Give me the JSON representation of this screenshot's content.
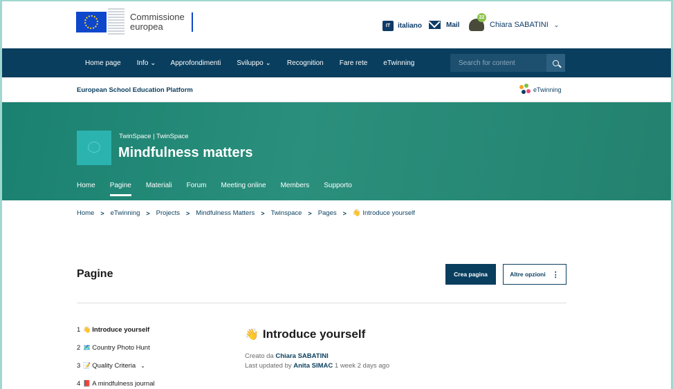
{
  "header": {
    "logo_text_line1": "Commissione",
    "logo_text_line2": "europea",
    "language_code": "IT",
    "language_label": "italiano",
    "mail_label": "Mail",
    "notification_count": "22",
    "user_name": "Chiara SABATINI"
  },
  "nav": {
    "items": [
      "Home page",
      "Info ⌄",
      "Approfondimenti",
      "Sviluppo ⌄",
      "Recognition",
      "Fare rete",
      "eTwinning"
    ],
    "search_placeholder": "Search for content"
  },
  "platform": {
    "title": "European School Education Platform",
    "etwinning_logo_label": "eTwinning"
  },
  "hero": {
    "subtitle": "TwinSpace | TwinSpace",
    "title": "Mindfulness matters",
    "tabs": [
      "Home",
      "Pagine",
      "Materiali",
      "Forum",
      "Meeting online",
      "Members",
      "Supporto"
    ],
    "active_tab": "Pagine"
  },
  "breadcrumb": [
    "Home",
    "eTwinning",
    "Projects",
    "Mindfulness Matters",
    "Twinspace",
    "Pages",
    "👋 Introduce yourself"
  ],
  "main": {
    "heading": "Pagine",
    "create_button": "Crea pagina",
    "more_button": "Altre opzioni",
    "pages": [
      {
        "num": "1",
        "emoji": "👋",
        "label": "Introduce yourself",
        "active": true
      },
      {
        "num": "2",
        "emoji": "🗺️",
        "label": "Country Photo Hunt"
      },
      {
        "num": "3",
        "emoji": "📝",
        "label": "Quality Criteria",
        "dropdown": "⌄"
      },
      {
        "num": "4",
        "emoji": "📕",
        "label": "A mindfulness journal"
      }
    ],
    "content": {
      "emoji": "👋",
      "title": "Introduce yourself",
      "created_prefix": "Creato da",
      "created_by": "Chiara SABATINI",
      "updated_prefix": "Last updated by",
      "updated_by": "Anita SIMAC",
      "updated_ago": "1 week 2 days ago"
    }
  }
}
